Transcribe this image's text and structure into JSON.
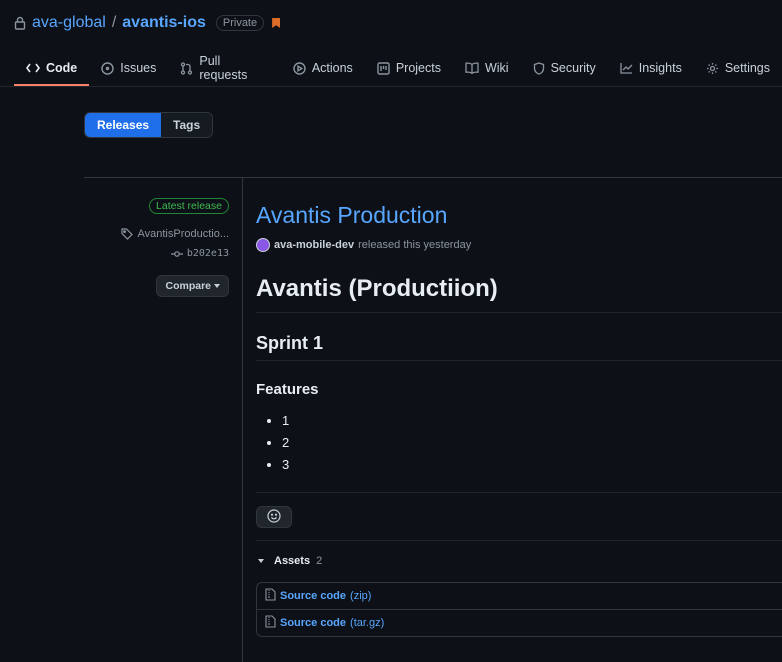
{
  "repo": {
    "owner": "ava-global",
    "separator": "/",
    "name": "avantis-ios",
    "visibility": "Private"
  },
  "tabs": [
    {
      "label": "Code",
      "icon": "code-icon",
      "active": true
    },
    {
      "label": "Issues",
      "icon": "issue-icon"
    },
    {
      "label": "Pull requests",
      "icon": "pull-request-icon"
    },
    {
      "label": "Actions",
      "icon": "play-icon"
    },
    {
      "label": "Projects",
      "icon": "project-icon"
    },
    {
      "label": "Wiki",
      "icon": "book-icon"
    },
    {
      "label": "Security",
      "icon": "shield-icon"
    },
    {
      "label": "Insights",
      "icon": "graph-icon"
    },
    {
      "label": "Settings",
      "icon": "gear-icon"
    }
  ],
  "toggle": {
    "releases": "Releases",
    "tags": "Tags"
  },
  "meta": {
    "latest_label": "Latest release",
    "tag_name": "AvantisProductio...",
    "commit": "b202e13",
    "compare_label": "Compare"
  },
  "release": {
    "title": "Avantis Production",
    "author": "ava-mobile-dev",
    "released_text": "released this yesterday",
    "heading1": "Avantis (Productiion)",
    "heading2": "Sprint 1",
    "heading3": "Features",
    "features": [
      "1",
      "2",
      "3"
    ]
  },
  "assets": {
    "label": "Assets",
    "count": "2",
    "items": [
      {
        "name": "Source code",
        "ext": "(zip)"
      },
      {
        "name": "Source code",
        "ext": "(tar.gz)"
      }
    ]
  },
  "colors": {
    "accent": "#58a6ff",
    "active_tab_underline": "#f78166",
    "latest_green": "#3fb950",
    "releases_button": "#1f6feb",
    "bookmark": "#db6d28"
  }
}
